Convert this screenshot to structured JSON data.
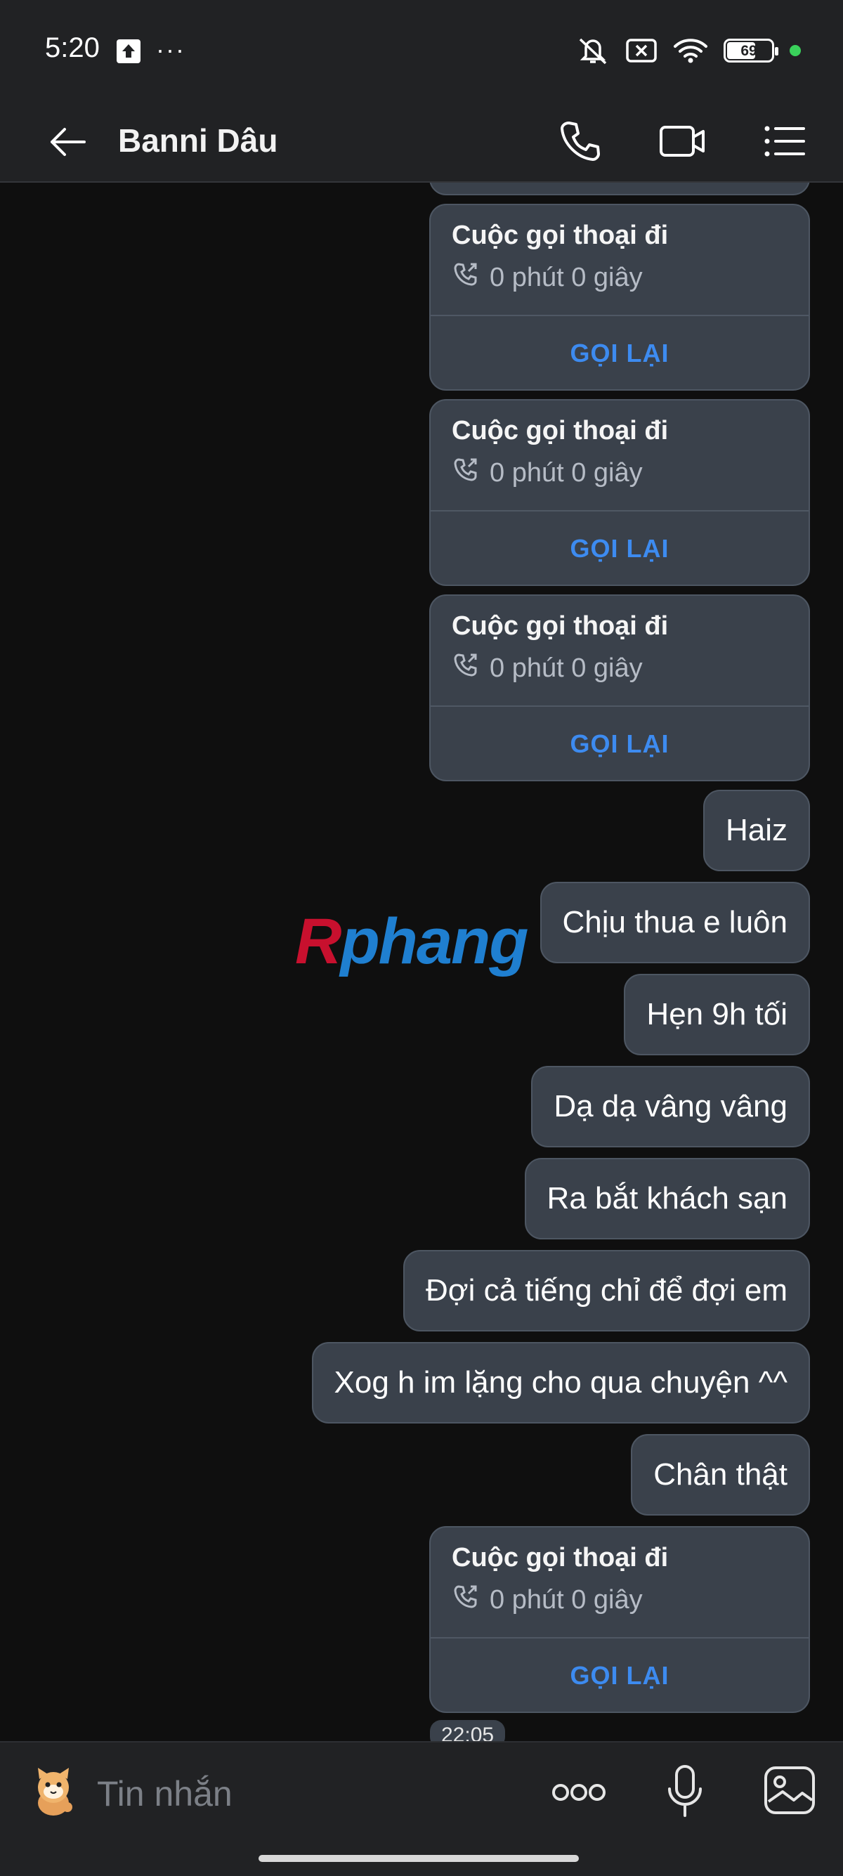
{
  "status_bar": {
    "time": "5:20",
    "overflow": "···",
    "battery": "69"
  },
  "header": {
    "title": "Banni Dâu",
    "icons": [
      "back-arrow-icon",
      "phone-icon",
      "video-call-icon",
      "menu-list-icon"
    ]
  },
  "call_label": {
    "title": "Cuộc gọi thoại đi",
    "duration": "0 phút 0 giây",
    "action": "GỌI LẠI"
  },
  "messages": [
    {
      "type": "call",
      "title": "Cuộc gọi thoại đi",
      "duration": "0 phút 0 giây",
      "action": "GỌI LẠI"
    },
    {
      "type": "call",
      "title": "Cuộc gọi thoại đi",
      "duration": "0 phút 0 giây",
      "action": "GỌI LẠI"
    },
    {
      "type": "call",
      "title": "Cuộc gọi thoại đi",
      "duration": "0 phút 0 giây",
      "action": "GỌI LẠI"
    },
    {
      "type": "text",
      "text": "Haiz"
    },
    {
      "type": "text",
      "text": "Chịu thua e luôn"
    },
    {
      "type": "text",
      "text": "Hẹn 9h tối"
    },
    {
      "type": "text",
      "text": "Dạ dạ vâng vâng"
    },
    {
      "type": "text",
      "text": "Ra bắt khách sạn"
    },
    {
      "type": "text",
      "text": "Đợi cả tiếng chỉ để đợi em"
    },
    {
      "type": "text",
      "text": "Xog h im lặng cho qua chuyện ^^"
    },
    {
      "type": "text",
      "text": "Chân thật"
    },
    {
      "type": "call",
      "title": "Cuộc gọi thoại đi",
      "duration": "0 phút 0 giây",
      "action": "GỌI LẠI"
    }
  ],
  "timestamp": "22:05",
  "watermark": {
    "first": "R",
    "rest": "phang"
  },
  "input": {
    "placeholder": "Tin nhắn"
  },
  "colors": {
    "background": "#0f0f0f",
    "bubble": "#3a414b",
    "accent": "#3d8bf0",
    "bar": "#212224"
  }
}
